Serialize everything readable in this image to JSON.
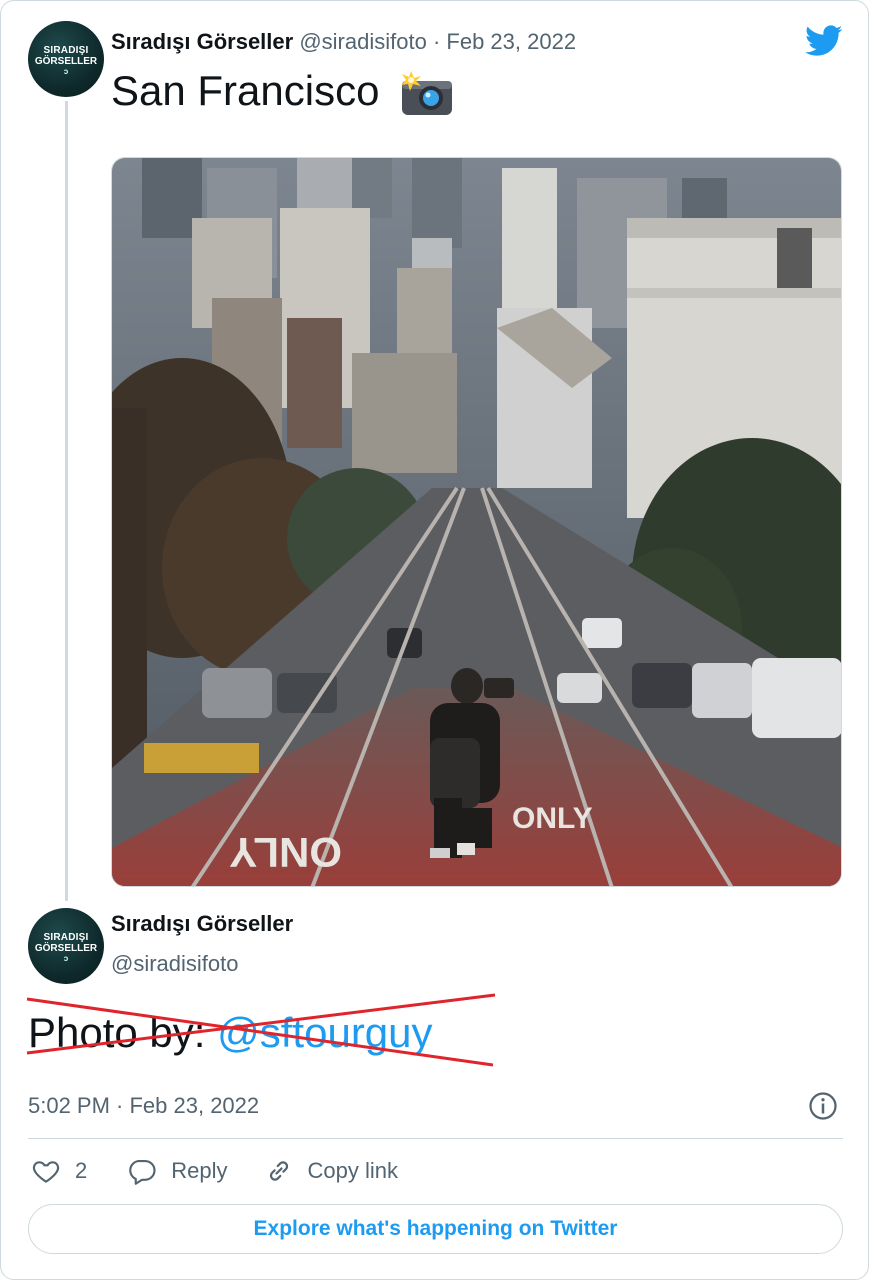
{
  "tweet": {
    "author_name": "Sıradışı Görseller",
    "handle": "@siradisifoto",
    "separator": "·",
    "date": "Feb 23, 2022",
    "text": "San Francisco",
    "avatar_text": [
      "SIRADIŞI",
      "GÖRSELLER",
      "ↄ"
    ]
  },
  "author_block": {
    "name": "Sıradışı Görseller",
    "handle": "@siradisifoto"
  },
  "credit": {
    "prefix": "Photo by: ",
    "mention": "@sftourguy"
  },
  "timestamp": "5:02 PM · Feb 23, 2022",
  "actions": {
    "like_count": "2",
    "reply_label": "Reply",
    "copy_label": "Copy link"
  },
  "explore_label": "Explore what's happening on Twitter",
  "colors": {
    "brand": "#1d9bf0",
    "secondary_text": "#536471",
    "strike": "#e0242b"
  },
  "icons": [
    "twitter-bird-icon",
    "camera-flash-icon",
    "info-icon",
    "heart-icon",
    "reply-bubble-icon",
    "link-icon"
  ]
}
